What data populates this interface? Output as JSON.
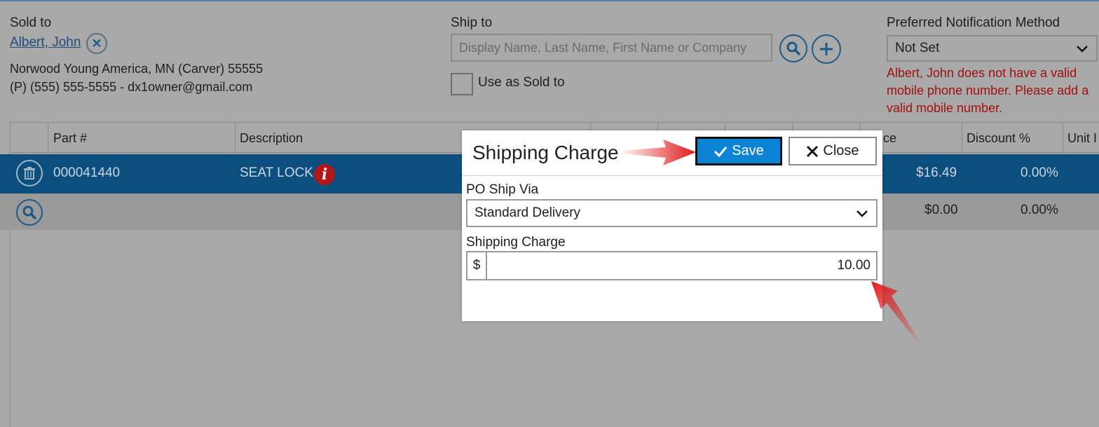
{
  "sold_to": {
    "label": "Sold to",
    "customer_name": "Albert, John",
    "address_line": "Norwood Young America, MN (Carver) 55555",
    "contact_line": "(P) (555) 555-5555 - dx1owner@gmail.com"
  },
  "ship_to": {
    "label": "Ship to",
    "search_placeholder": "Display Name, Last Name, First Name or Company",
    "use_as_sold_to_label": "Use as Sold to"
  },
  "notification": {
    "label": "Preferred Notification Method",
    "selected": "Not Set",
    "warning": "Albert, John does not have a valid mobile phone number. Please add a valid mobile number."
  },
  "grid": {
    "headers": {
      "part": "Part #",
      "description": "Description",
      "price_partial": "ce",
      "discount": "Discount %",
      "unit_partial": "Unit I"
    },
    "rows": [
      {
        "part": "000041440",
        "description": "SEAT LOCK",
        "price": "$16.49",
        "discount": "0.00%"
      },
      {
        "part": "",
        "description": "",
        "price": "$0.00",
        "discount": "0.00%"
      }
    ]
  },
  "modal": {
    "title": "Shipping Charge",
    "save_label": "Save",
    "close_label": "Close",
    "ship_via_label": "PO Ship Via",
    "ship_via_value": "Standard Delivery",
    "charge_label": "Shipping Charge",
    "currency_prefix": "$",
    "charge_value": "10.00"
  },
  "colors": {
    "selected_row": "#0c4f7e",
    "save_button": "#0d83d6",
    "warning_text": "#a01010",
    "annotation_arrow": "#e01818",
    "icon_blue": "#1f5a86"
  }
}
